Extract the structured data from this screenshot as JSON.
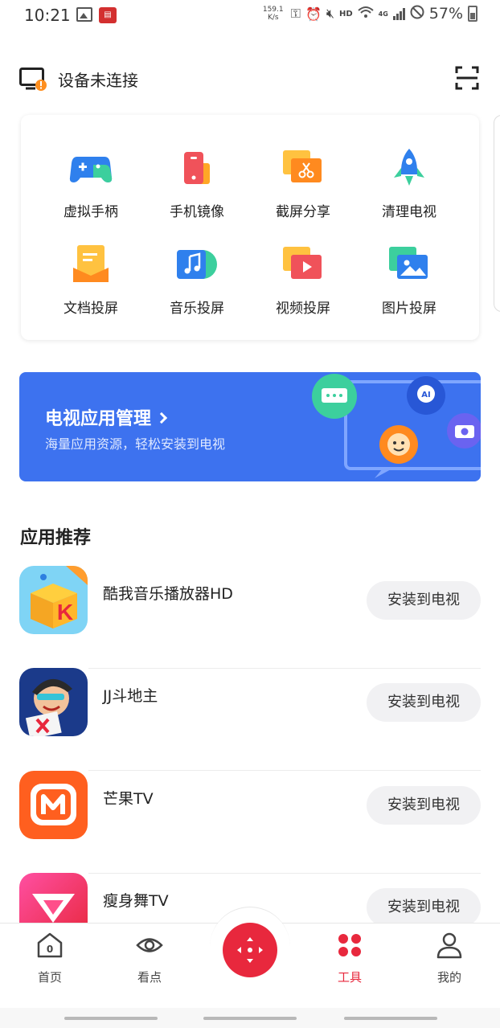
{
  "status_bar": {
    "time": "10:21",
    "net_speed_value": "159.1",
    "net_speed_unit": "K/s",
    "hd": "HD",
    "network": "4G",
    "battery": "57%"
  },
  "device": {
    "status_text": "设备未连接"
  },
  "tools": [
    {
      "label": "虚拟手柄",
      "icon": "gamepad-icon"
    },
    {
      "label": "手机镜像",
      "icon": "phone-mirror-icon"
    },
    {
      "label": "截屏分享",
      "icon": "screenshot-share-icon"
    },
    {
      "label": "清理电视",
      "icon": "rocket-icon"
    },
    {
      "label": "文档投屏",
      "icon": "document-icon"
    },
    {
      "label": "音乐投屏",
      "icon": "music-icon"
    },
    {
      "label": "视频投屏",
      "icon": "video-icon"
    },
    {
      "label": "图片投屏",
      "icon": "picture-icon"
    }
  ],
  "banner": {
    "title": "电视应用管理",
    "subtitle": "海量应用资源，轻松安装到电视",
    "ai_badge": "AI",
    "color": "#3d72ef"
  },
  "recommend": {
    "title": "应用推荐",
    "apps": [
      {
        "name": "酷我音乐播放器HD",
        "button": "安装到电视"
      },
      {
        "name": "JJ斗地主",
        "button": "安装到电视"
      },
      {
        "name": "芒果TV",
        "button": "安装到电视"
      },
      {
        "name": "瘦身舞TV",
        "button": "安装到电视"
      }
    ]
  },
  "nav": {
    "home": "首页",
    "watch": "看点",
    "tools": "工具",
    "mine": "我的",
    "home_badge": "0",
    "active_color": "#e8283d"
  }
}
